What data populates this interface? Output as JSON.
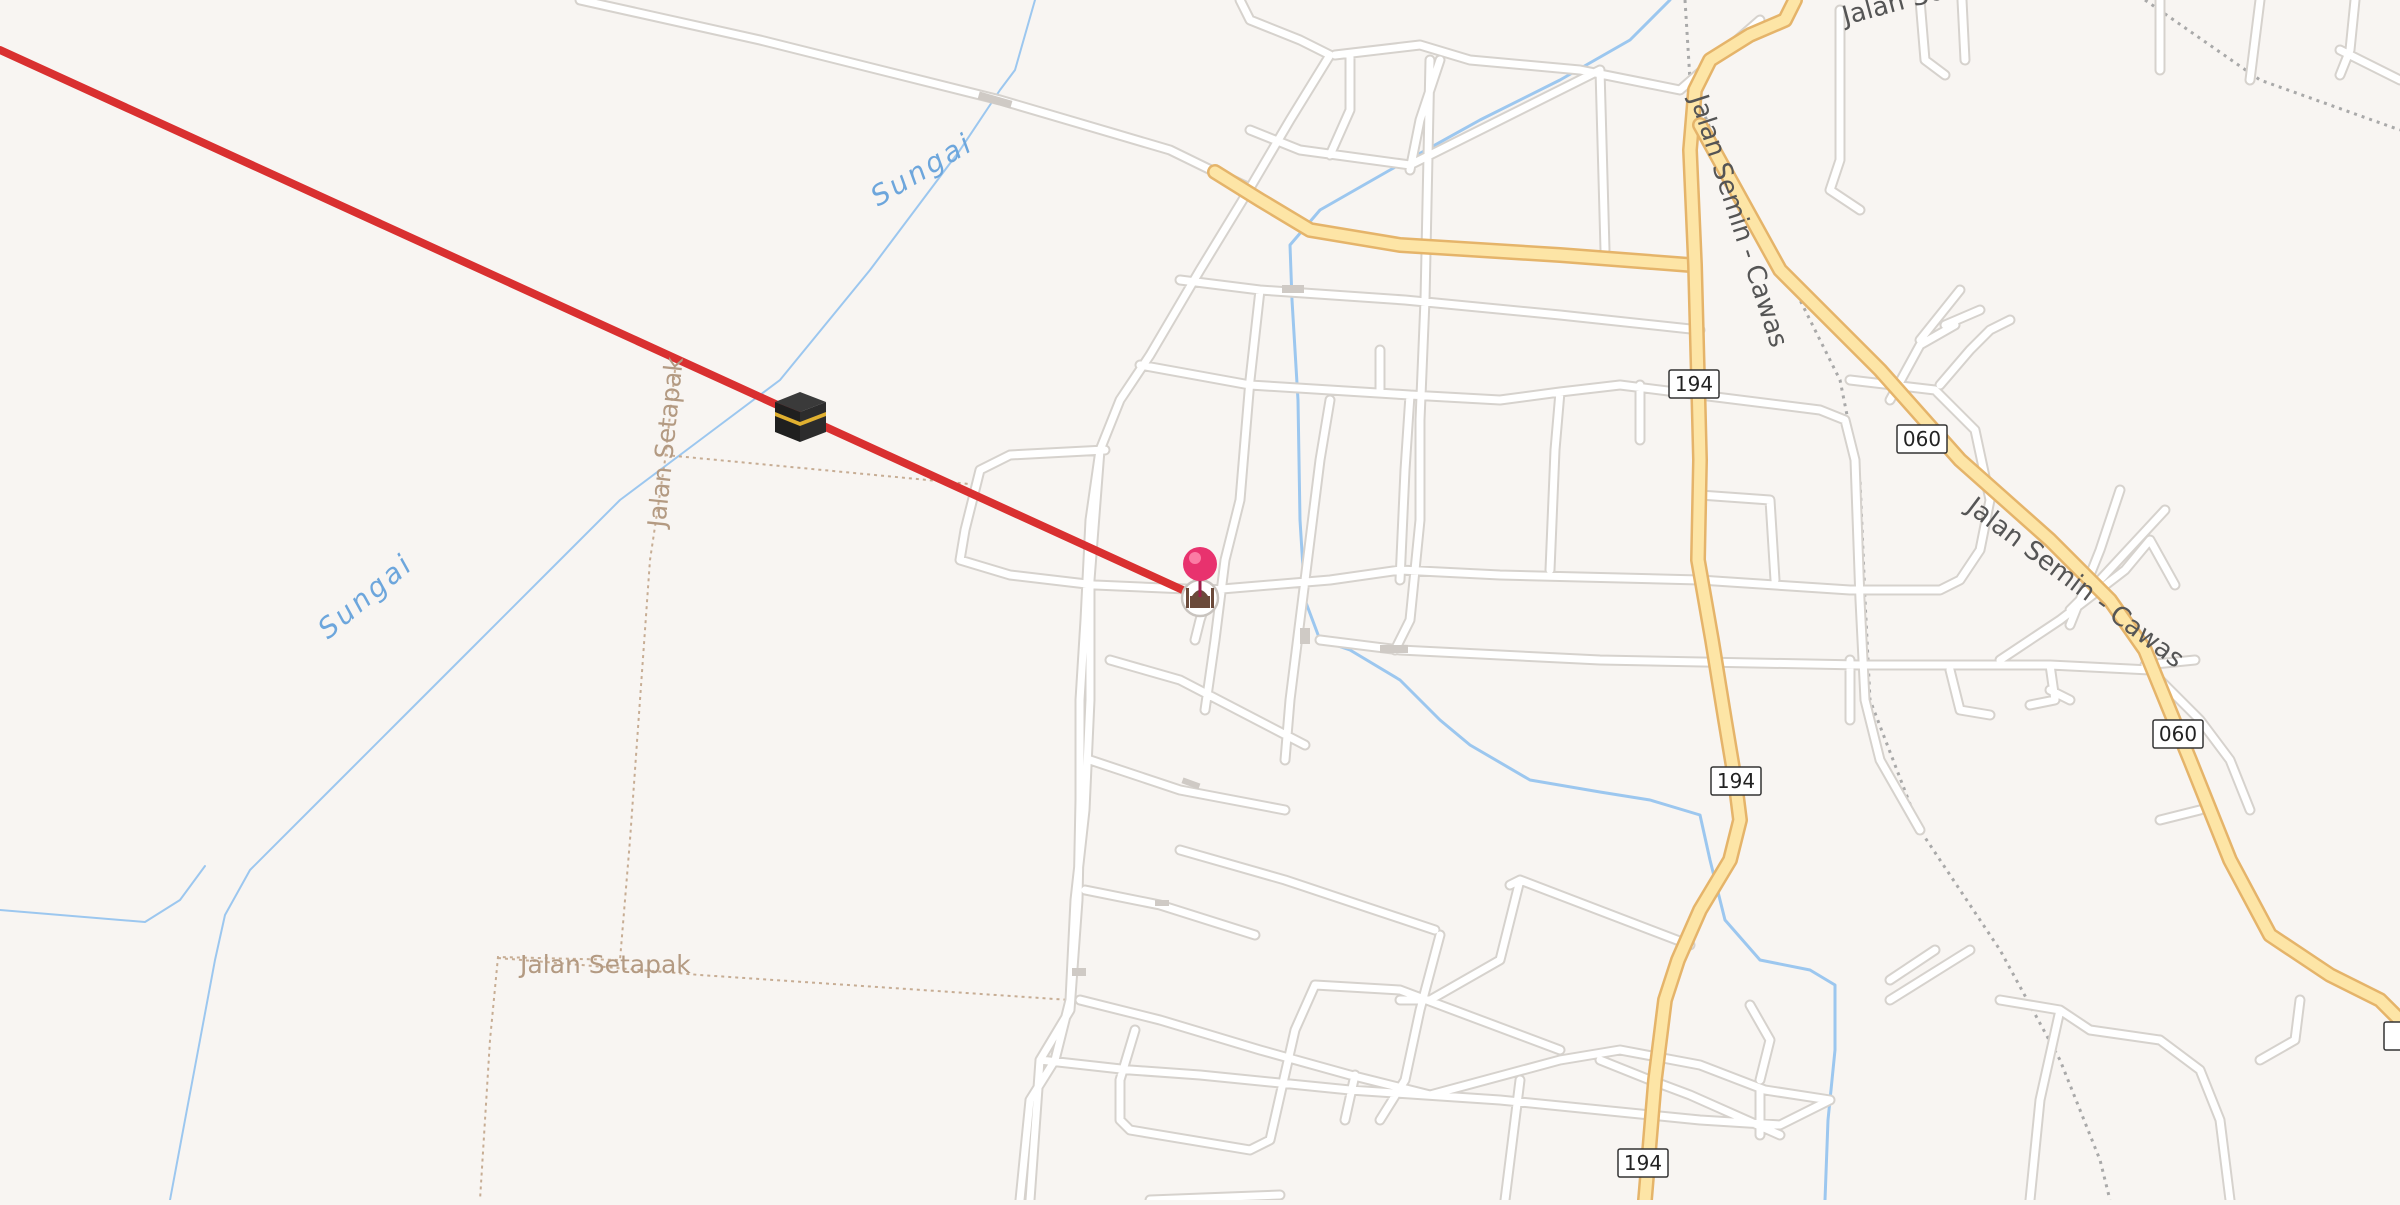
{
  "map": {
    "river_label": "Sungai",
    "path_label": "Jalan Setapak",
    "road_label": "Jalan Semin - Cawas",
    "route_shields": [
      "194",
      "060"
    ]
  },
  "markers": {
    "destination_pin": "pink-map-pin-icon",
    "mosque": "mosque-icon",
    "kaaba": "kaaba-icon"
  },
  "qibla_line_color": "#d93030",
  "colors": {
    "background": "#f8f5f2",
    "river": "#9cc7ef",
    "main_road": "#fde5a6",
    "pin": "#e8326e"
  }
}
